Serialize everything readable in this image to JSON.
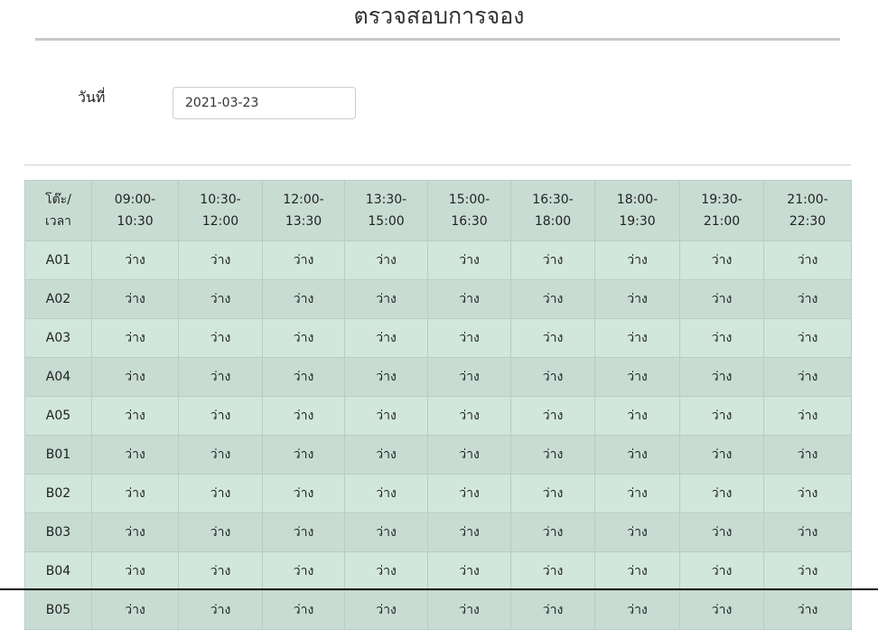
{
  "page_title": "ตรวจสอบการจอง",
  "date_label": "วันที่",
  "date_value": "2021-03-23",
  "table": {
    "corner_header": [
      "โต๊ะ/",
      "เวลา"
    ],
    "time_slots": [
      [
        "09:00-",
        "10:30"
      ],
      [
        "10:30-",
        "12:00"
      ],
      [
        "12:00-",
        "13:30"
      ],
      [
        "13:30-",
        "15:00"
      ],
      [
        "15:00-",
        "16:30"
      ],
      [
        "16:30-",
        "18:00"
      ],
      [
        "18:00-",
        "19:30"
      ],
      [
        "19:30-",
        "21:00"
      ],
      [
        "21:00-",
        "22:30"
      ]
    ],
    "rows": [
      {
        "table": "A01",
        "status": [
          "ว่าง",
          "ว่าง",
          "ว่าง",
          "ว่าง",
          "ว่าง",
          "ว่าง",
          "ว่าง",
          "ว่าง",
          "ว่าง"
        ]
      },
      {
        "table": "A02",
        "status": [
          "ว่าง",
          "ว่าง",
          "ว่าง",
          "ว่าง",
          "ว่าง",
          "ว่าง",
          "ว่าง",
          "ว่าง",
          "ว่าง"
        ]
      },
      {
        "table": "A03",
        "status": [
          "ว่าง",
          "ว่าง",
          "ว่าง",
          "ว่าง",
          "ว่าง",
          "ว่าง",
          "ว่าง",
          "ว่าง",
          "ว่าง"
        ]
      },
      {
        "table": "A04",
        "status": [
          "ว่าง",
          "ว่าง",
          "ว่าง",
          "ว่าง",
          "ว่าง",
          "ว่าง",
          "ว่าง",
          "ว่าง",
          "ว่าง"
        ]
      },
      {
        "table": "A05",
        "status": [
          "ว่าง",
          "ว่าง",
          "ว่าง",
          "ว่าง",
          "ว่าง",
          "ว่าง",
          "ว่าง",
          "ว่าง",
          "ว่าง"
        ]
      },
      {
        "table": "B01",
        "status": [
          "ว่าง",
          "ว่าง",
          "ว่าง",
          "ว่าง",
          "ว่าง",
          "ว่าง",
          "ว่าง",
          "ว่าง",
          "ว่าง"
        ]
      },
      {
        "table": "B02",
        "status": [
          "ว่าง",
          "ว่าง",
          "ว่าง",
          "ว่าง",
          "ว่าง",
          "ว่าง",
          "ว่าง",
          "ว่าง",
          "ว่าง"
        ]
      },
      {
        "table": "B03",
        "status": [
          "ว่าง",
          "ว่าง",
          "ว่าง",
          "ว่าง",
          "ว่าง",
          "ว่าง",
          "ว่าง",
          "ว่าง",
          "ว่าง"
        ]
      },
      {
        "table": "B04",
        "status": [
          "ว่าง",
          "ว่าง",
          "ว่าง",
          "ว่าง",
          "ว่าง",
          "ว่าง",
          "ว่าง",
          "ว่าง",
          "ว่าง"
        ]
      },
      {
        "table": "B05",
        "status": [
          "ว่าง",
          "ว่าง",
          "ว่าง",
          "ว่าง",
          "ว่าง",
          "ว่าง",
          "ว่าง",
          "ว่าง",
          "ว่าง"
        ]
      }
    ]
  }
}
